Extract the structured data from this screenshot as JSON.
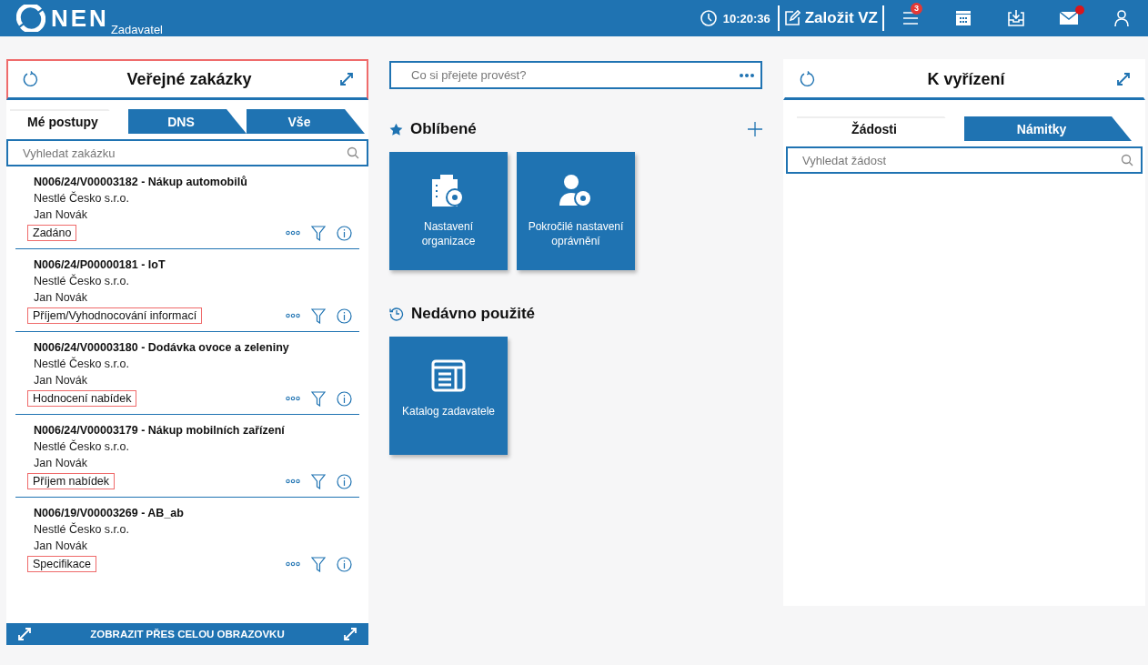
{
  "header": {
    "logo": "NEN",
    "subtitle": "Zadavatel",
    "time": "10:20:36",
    "create_button": "Založit VZ",
    "menu_badge": "3",
    "mail_unread": true
  },
  "left_panel": {
    "title": "Veřejné zakázky",
    "highlighted": true,
    "tabs": [
      {
        "label": "Mé postupy",
        "selected": true
      },
      {
        "label": "DNS",
        "selected": false
      },
      {
        "label": "Vše",
        "selected": false
      }
    ],
    "search": {
      "placeholder": "Vyhledat zakázku"
    },
    "items": [
      {
        "title": "N006/24/V00003182 - Nákup automobilů",
        "organization": "Nestlé Česko s.r.o.",
        "person": "Jan Novák",
        "status": "Zadáno",
        "highlighted": true
      },
      {
        "title": "N006/24/P00000181 - IoT",
        "organization": "Nestlé Česko s.r.o.",
        "person": "Jan Novák",
        "status": "Příjem/Vyhodnocování informací",
        "highlighted": true
      },
      {
        "title": "N006/24/V00003180 - Dodávka ovoce a zeleniny",
        "organization": "Nestlé Česko s.r.o.",
        "person": "Jan Novák",
        "status": "Hodnocení nabídek",
        "highlighted": true
      },
      {
        "title": "N006/24/V00003179 - Nákup mobilních zařízení",
        "organization": "Nestlé Česko s.r.o.",
        "person": "Jan Novák",
        "status": "Příjem nabídek",
        "highlighted": true
      },
      {
        "title": "N006/19/V00003269 - AB_ab",
        "organization": "Nestlé Česko s.r.o.",
        "person": "Jan Novák",
        "status": "Specifikace",
        "highlighted": true
      }
    ],
    "footer": "ZOBRAZIT PŘES CELOU OBRAZOVKU"
  },
  "command": {
    "placeholder": "Co si přejete provést?"
  },
  "favorites": {
    "title": "Oblíbené",
    "tiles": [
      {
        "label": "Nastavení organizace",
        "kind": "building"
      },
      {
        "label": "Pokročilé nastavení oprávnění",
        "kind": "user"
      }
    ]
  },
  "recent": {
    "title": "Nedávno použité",
    "tiles": [
      {
        "label": "Katalog zadavatele",
        "kind": "catalog"
      }
    ]
  },
  "right_panel": {
    "title": "K vyřízení",
    "highlighted": false,
    "tabs": [
      {
        "label": "Žádosti",
        "selected": true
      },
      {
        "label": "Námitky",
        "selected": false
      }
    ],
    "search": {
      "placeholder": "Vyhledat žádost"
    }
  }
}
